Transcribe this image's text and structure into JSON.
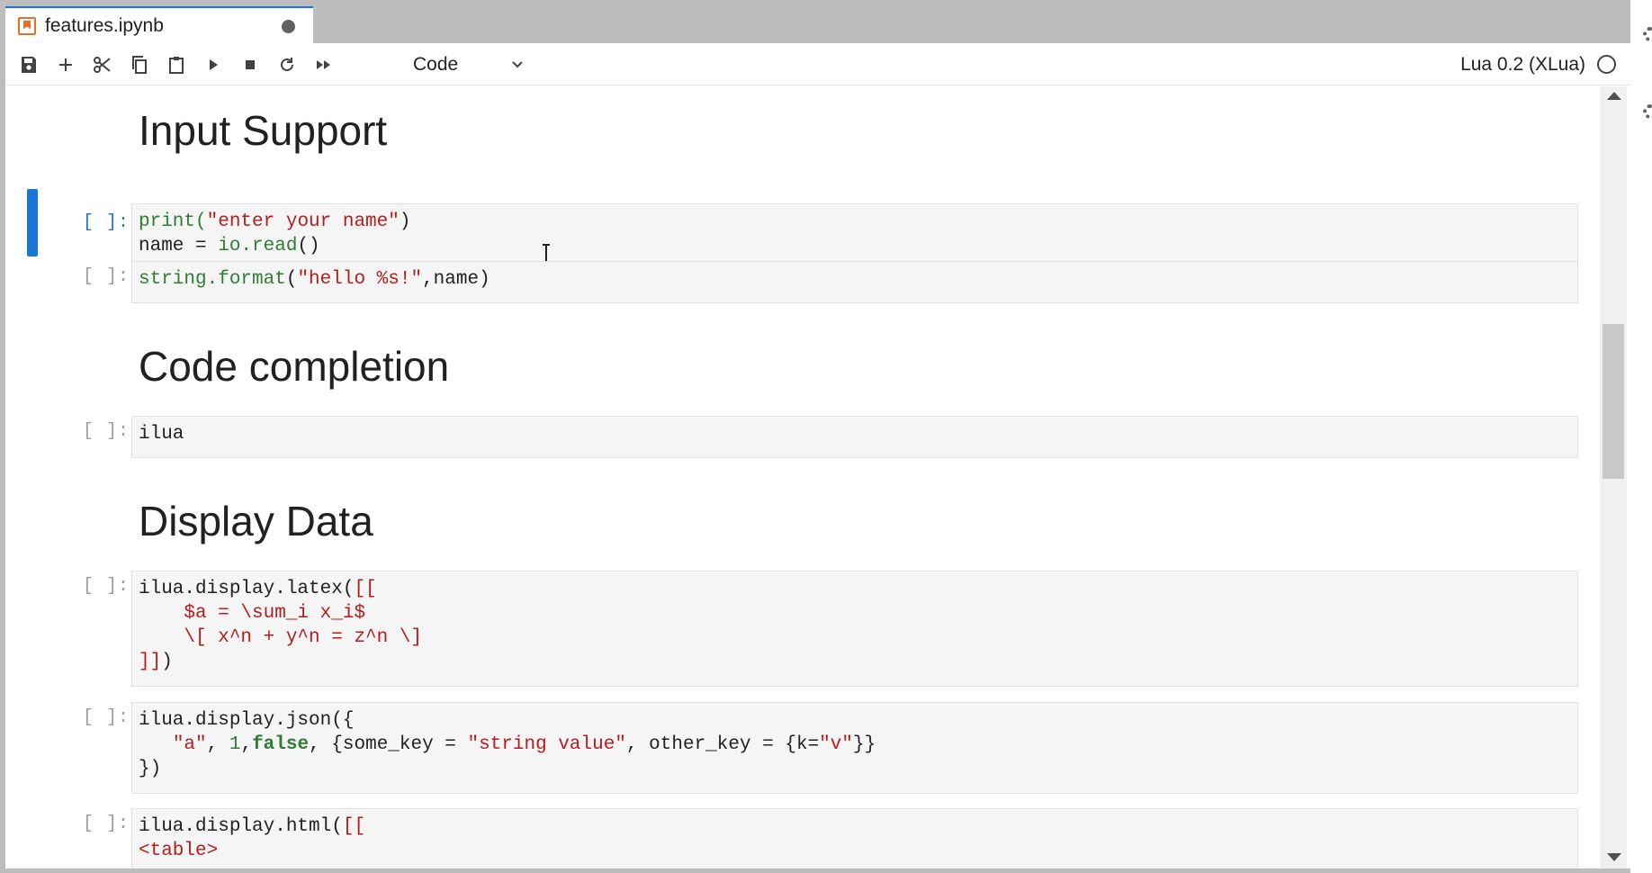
{
  "tab": {
    "title": "features.ipynb"
  },
  "toolbar": {
    "cell_type": "Code",
    "kernel_name": "Lua 0.2 (XLua)"
  },
  "headings": {
    "input_support": "Input Support",
    "code_completion": "Code completion",
    "display_data": "Display Data"
  },
  "prompt": "[ ]:",
  "cells": {
    "c1": {
      "l1a": "print(",
      "l1b": "\"enter your name\"",
      "l1c": ")",
      "l2a": "name = ",
      "l2b": "io.read",
      "l2c": "()"
    },
    "c2": {
      "a": "string.format",
      "b": "(",
      "c": "\"hello %s!\"",
      "d": ",name)"
    },
    "c3": {
      "a": "ilua"
    },
    "c4": {
      "l1a": "ilua.display.latex(",
      "l1b": "[[",
      "l2": "    $a = \\sum_i x_i$",
      "l3": "    \\[ x^n + y^n = z^n \\]",
      "l4a": "]]",
      "l4b": ")"
    },
    "c5": {
      "l1": "ilua.display.json({",
      "l2a": "   ",
      "l2b": "\"a\"",
      "l2c": ", ",
      "l2d": "1",
      "l2e": ",",
      "l2f": "false",
      "l2g": ", {some_key = ",
      "l2h": "\"string value\"",
      "l2i": ", other_key = {k=",
      "l2j": "\"v\"",
      "l2k": "}}",
      "l3": "})"
    },
    "c6": {
      "l1a": "ilua.display.html(",
      "l1b": "[[",
      "l2": "<table>"
    }
  }
}
